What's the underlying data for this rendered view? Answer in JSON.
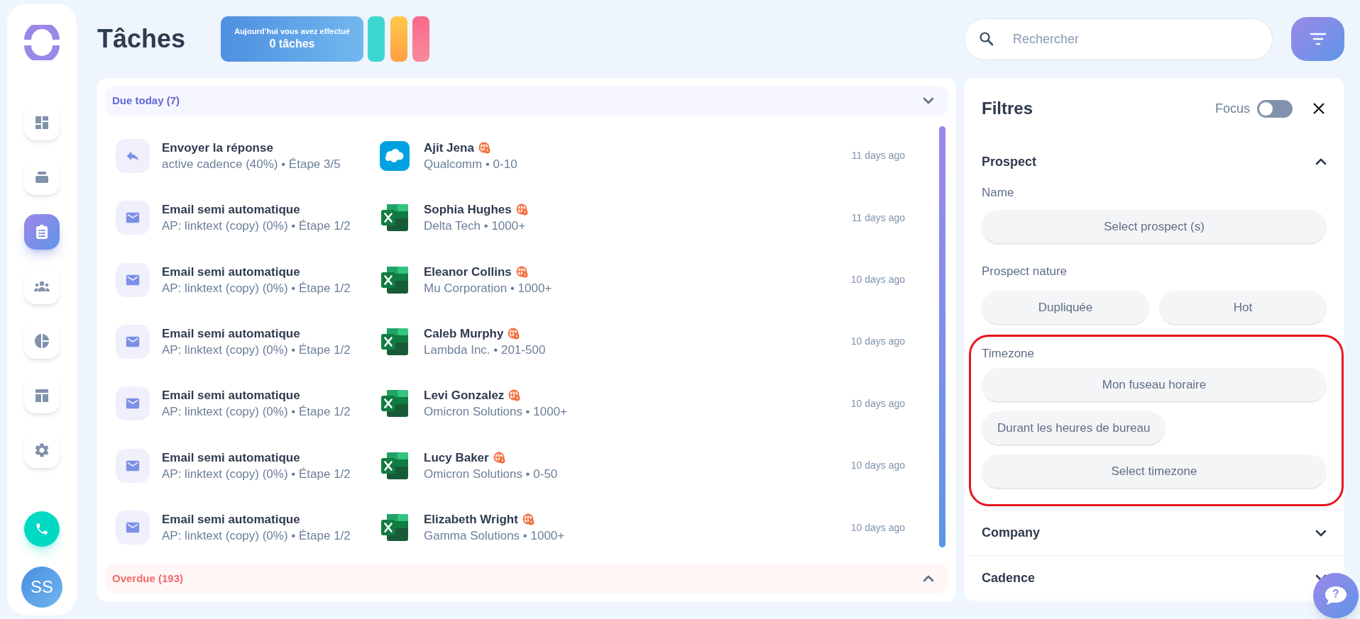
{
  "sidebar": {
    "items": [
      {
        "kind": "dashboard",
        "selected": false
      },
      {
        "kind": "stack",
        "selected": false
      },
      {
        "kind": "tasks",
        "selected": true
      },
      {
        "kind": "team",
        "selected": false
      },
      {
        "kind": "reports",
        "selected": false
      },
      {
        "kind": "layout",
        "selected": false
      },
      {
        "kind": "settings",
        "selected": false
      }
    ],
    "avatar": {
      "initials": "SS"
    }
  },
  "header": {
    "title": "Tâches",
    "banner": {
      "caption": "Aujourd’hui vous avez effectué",
      "count": "0 tâches"
    },
    "search": {
      "placeholder": "Rechercher"
    }
  },
  "task_groups": [
    {
      "kind": "due",
      "label": "Due today (7)",
      "expanded": true,
      "tasks": [
        {
          "kind": "reply",
          "title": "Envoyer la réponse",
          "subtitle": "active cadence (40%) • Étape 3/5",
          "crm": {
            "kind": "cloud"
          },
          "contact": "Ajit Jena",
          "company": "Qualcomm • 0-10",
          "time": "11 days ago"
        },
        {
          "kind": "email",
          "title": "Email semi automatique",
          "subtitle": "AP: linktext (copy) (0%) • Étape 1/2",
          "crm": {
            "kind": "sheet"
          },
          "contact": "Sophia Hughes",
          "company": "Delta Tech • 1000+",
          "time": "11 days ago"
        },
        {
          "kind": "email",
          "title": "Email semi automatique",
          "subtitle": "AP: linktext (copy) (0%) • Étape 1/2",
          "crm": {
            "kind": "sheet"
          },
          "contact": "Eleanor Collins",
          "company": "Mu Corporation • 1000+",
          "time": "10 days ago"
        },
        {
          "kind": "email",
          "title": "Email semi automatique",
          "subtitle": "AP: linktext (copy) (0%) • Étape 1/2",
          "crm": {
            "kind": "sheet"
          },
          "contact": "Caleb Murphy",
          "company": "Lambda Inc. • 201-500",
          "time": "10 days ago"
        },
        {
          "kind": "email",
          "title": "Email semi automatique",
          "subtitle": "AP: linktext (copy) (0%) • Étape 1/2",
          "crm": {
            "kind": "sheet"
          },
          "contact": "Levi Gonzalez",
          "company": "Omicron Solutions • 1000+",
          "time": "10 days ago"
        },
        {
          "kind": "email",
          "title": "Email semi automatique",
          "subtitle": "AP: linktext (copy) (0%) • Étape 1/2",
          "crm": {
            "kind": "sheet"
          },
          "contact": "Lucy Baker",
          "company": "Omicron Solutions • 0-50",
          "time": "10 days ago"
        },
        {
          "kind": "email",
          "title": "Email semi automatique",
          "subtitle": "AP: linktext (copy) (0%) • Étape 1/2",
          "crm": {
            "kind": "sheet"
          },
          "contact": "Elizabeth Wright",
          "company": "Gamma Solutions • 1000+",
          "time": "10 days ago"
        }
      ]
    },
    {
      "kind": "overdue",
      "label": "Overdue (193)",
      "expanded": false
    }
  ],
  "filters": {
    "title": "Filtres",
    "focus": {
      "label": "Focus",
      "on": false
    },
    "sections": [
      {
        "title": "Prospect",
        "expanded": true,
        "groups": [
          {
            "label": "Name",
            "highlighted": false,
            "options": [
              {
                "kind": "block",
                "label": "Select prospect (s)"
              }
            ]
          },
          {
            "label": "Prospect nature",
            "highlighted": false,
            "options": [
              {
                "kind": "half",
                "label": "Dupliquée"
              },
              {
                "kind": "half",
                "label": "Hot"
              }
            ]
          },
          {
            "label": "Timezone",
            "highlighted": true,
            "options": [
              {
                "kind": "block",
                "label": "Mon fuseau horaire"
              },
              {
                "kind": "chip",
                "label": "Durant les heures de bureau"
              },
              {
                "kind": "block",
                "label": "Select timezone"
              }
            ]
          }
        ]
      },
      {
        "title": "Company",
        "expanded": false
      },
      {
        "title": "Cadence",
        "expanded": false
      }
    ]
  },
  "help_button": {
    "glyph": "?"
  }
}
